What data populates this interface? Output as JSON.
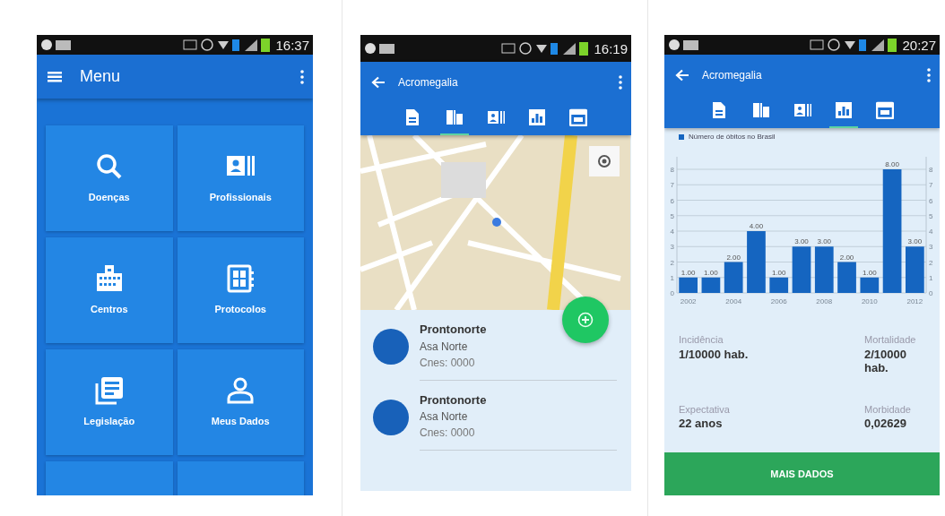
{
  "screens": [
    {
      "kind": "menu",
      "status_bar": {
        "time": "16:37"
      },
      "app_bar": {
        "title": "Menu"
      },
      "tiles": [
        {
          "kind": "item",
          "label": "Doenças"
        },
        {
          "kind": "item",
          "label": "Profissionais"
        },
        {
          "kind": "item",
          "label": "Centros"
        },
        {
          "kind": "item",
          "label": "Protocolos"
        },
        {
          "kind": "item",
          "label": "Legislação"
        },
        {
          "kind": "item",
          "label": "Meus Dados"
        },
        {
          "kind": "cut"
        },
        {
          "kind": "cut"
        }
      ]
    },
    {
      "kind": "map",
      "status_bar": {
        "time": "16:19"
      },
      "app_bar": {
        "title": "Acromegalia"
      },
      "tabs": [
        {
          "selected": false
        },
        {
          "selected": true
        },
        {
          "selected": false
        },
        {
          "selected": false
        },
        {
          "selected": false
        }
      ],
      "places": [
        {
          "name": "Prontonorte",
          "area": "Asa Norte",
          "code": "Cnes: 0000"
        },
        {
          "name": "Prontonorte",
          "area": "Asa Norte",
          "code": "Cnes: 0000"
        }
      ]
    },
    {
      "kind": "chart",
      "status_bar": {
        "time": "20:27"
      },
      "app_bar": {
        "title": "Acromegalia"
      },
      "tabs": [
        {
          "selected": false
        },
        {
          "selected": false
        },
        {
          "selected": false
        },
        {
          "selected": true
        },
        {
          "selected": false
        }
      ],
      "chart_data": {
        "type": "bar",
        "x": [
          2002,
          2003,
          2004,
          2005,
          2006,
          2007,
          2008,
          2009,
          2010,
          2011,
          2012
        ],
        "grid": true,
        "series": [
          {
            "name": "Número de óbitos no Brasil",
            "color": "#1565c0",
            "values": [
              1,
              1,
              2,
              4,
              1,
              3,
              3,
              2,
              1,
              8,
              3
            ]
          }
        ],
        "xlim": [
          2001.5,
          2012.5
        ],
        "ylim": [
          0,
          8
        ],
        "yticks": [
          0,
          1,
          2,
          3,
          4,
          5,
          6,
          7,
          8
        ],
        "xticks": [
          2002,
          2004,
          2006,
          2008,
          2010,
          2012
        ],
        "value_labels": [
          "1.00",
          "1.00",
          "2.00",
          "4.00",
          "1.00",
          "3.00",
          "3.00",
          "2.00",
          "1.00",
          "8.00",
          "3.00"
        ]
      },
      "right_axis_labels": [
        "8",
        "7",
        "6",
        "5",
        "4",
        "3",
        "2",
        "1",
        "0"
      ],
      "stats": [
        {
          "label": "Incidência",
          "value": "1/10000 hab."
        },
        {
          "label": "Mortalidade",
          "value": "2/10000 hab."
        },
        {
          "label": "Expectativa",
          "value": "22 anos"
        },
        {
          "label": "Morbidade",
          "value": "0,02629"
        }
      ],
      "button": "MAIS DADOS"
    }
  ]
}
